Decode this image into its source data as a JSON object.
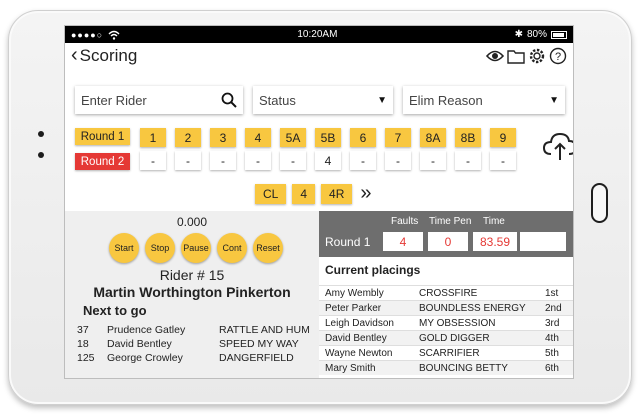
{
  "status_bar": {
    "signal": "●●●●○",
    "time": "10:20AM",
    "battery": "80%"
  },
  "header": {
    "title": "Scoring"
  },
  "filters": {
    "rider_placeholder": "Enter Rider",
    "status": "Status",
    "elim_reason": "Elim Reason"
  },
  "rounds": {
    "round1_label": "Round 1",
    "round2_label": "Round 2",
    "fences": [
      {
        "label": "1",
        "value": "-"
      },
      {
        "label": "2",
        "value": "-"
      },
      {
        "label": "3",
        "value": "-"
      },
      {
        "label": "4",
        "value": "-"
      },
      {
        "label": "5A",
        "value": "-"
      },
      {
        "label": "5B",
        "value": "4"
      },
      {
        "label": "6",
        "value": "-"
      },
      {
        "label": "7",
        "value": "-"
      },
      {
        "label": "8A",
        "value": "-"
      },
      {
        "label": "8B",
        "value": "-"
      },
      {
        "label": "9",
        "value": "-"
      }
    ],
    "extra": [
      "CL",
      "4",
      "4R"
    ],
    "more_icon": "double-chevron-right"
  },
  "timer": {
    "value": "0.000",
    "buttons": [
      "Start",
      "Stop",
      "Pause",
      "Cont",
      "Reset"
    ]
  },
  "current_rider": {
    "number_label": "Rider # 15",
    "name": "Martin Worthington Pinkerton"
  },
  "next_to_go": {
    "title": "Next to go",
    "riders": [
      {
        "num": "37",
        "name": "Prudence Gatley",
        "horse": "RATTLE AND HUM"
      },
      {
        "num": "18",
        "name": "David Bentley",
        "horse": "SPEED MY WAY"
      },
      {
        "num": "125",
        "name": "George Crowley",
        "horse": "DANGERFIELD"
      }
    ]
  },
  "score": {
    "faults_label": "Faults",
    "timepen_label": "Time Pen",
    "time_label": "Time",
    "round_label": "Round 1",
    "faults": "4",
    "time_penalty": "0",
    "time": "83.59",
    "extra": ""
  },
  "placings": {
    "title": "Current placings",
    "rows": [
      {
        "rider": "Amy Wembly",
        "horse": "CROSSFIRE",
        "place": "1st"
      },
      {
        "rider": "Peter Parker",
        "horse": "BOUNDLESS ENERGY",
        "place": "2nd"
      },
      {
        "rider": "Leigh Davidson",
        "horse": "MY OBSESSION",
        "place": "3rd"
      },
      {
        "rider": "David Bentley",
        "horse": "GOLD DIGGER",
        "place": "4th"
      },
      {
        "rider": "Wayne Newton",
        "horse": "SCARRIFIER",
        "place": "5th"
      },
      {
        "rider": "Mary Smith",
        "horse": "BOUNCING BETTY",
        "place": "6th"
      }
    ]
  },
  "colors": {
    "accent": "#f8c740",
    "danger": "#e53935",
    "panel": "#6e6e6e"
  }
}
